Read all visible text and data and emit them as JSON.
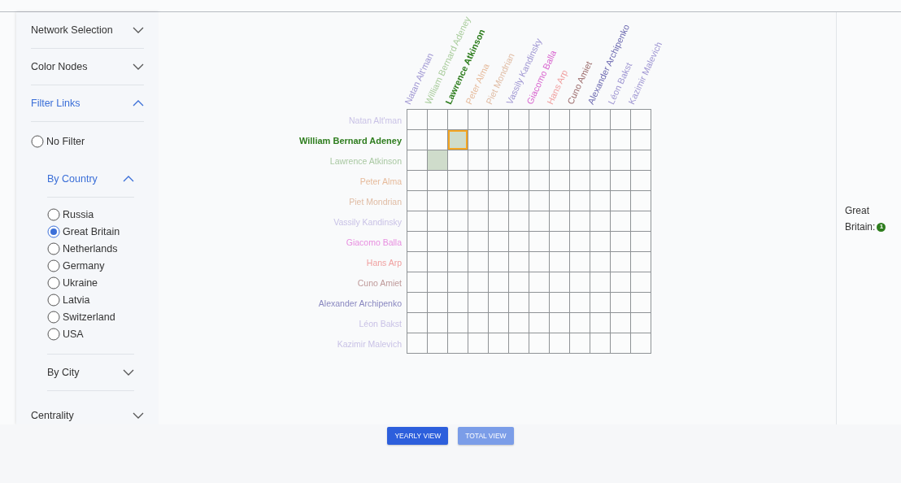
{
  "sidebar": {
    "sections": [
      {
        "title": "Network Selection",
        "expanded": false
      },
      {
        "title": "Color Nodes",
        "expanded": false
      },
      {
        "title": "Filter Links",
        "expanded": true,
        "options": [
          {
            "label": "No Filter",
            "selected": false
          }
        ],
        "subsections": [
          {
            "title": "By Country",
            "expanded": true,
            "options": [
              {
                "label": "Russia",
                "selected": false
              },
              {
                "label": "Great Britain",
                "selected": true
              },
              {
                "label": "Netherlands",
                "selected": false
              },
              {
                "label": "Germany",
                "selected": false
              },
              {
                "label": "Ukraine",
                "selected": false
              },
              {
                "label": "Latvia",
                "selected": false
              },
              {
                "label": "Switzerland",
                "selected": false
              },
              {
                "label": "USA",
                "selected": false
              }
            ]
          },
          {
            "title": "By City",
            "expanded": false
          }
        ]
      },
      {
        "title": "Centrality",
        "expanded": false
      }
    ]
  },
  "matrix": {
    "columns": [
      {
        "label": "Natan Alt'man",
        "color": "#9f96d2",
        "highlighted": false
      },
      {
        "label": "William Bernard Adeney",
        "color": "#a9cc9c",
        "highlighted": false
      },
      {
        "label": "Lawrence Atkinson",
        "color": "#2e7d1e",
        "highlighted": true
      },
      {
        "label": "Peter Alma",
        "color": "#e6bb9c",
        "highlighted": false
      },
      {
        "label": "Piet Mondrian",
        "color": "#e0bca4",
        "highlighted": false
      },
      {
        "label": "Vassily Kandinsky",
        "color": "#9f96d2",
        "highlighted": false
      },
      {
        "label": "Giacomo Balla",
        "color": "#d864cf",
        "highlighted": false
      },
      {
        "label": "Hans Arp",
        "color": "#f0a0a0",
        "highlighted": false
      },
      {
        "label": "Cuno Amiet",
        "color": "#9c6c6c",
        "highlighted": false
      },
      {
        "label": "Alexander Archipenko",
        "color": "#6c69b0",
        "highlighted": false
      },
      {
        "label": "Léon Bakst",
        "color": "#9f96d2",
        "highlighted": false
      },
      {
        "label": "Kazimir Malevich",
        "color": "#9f96d2",
        "highlighted": false
      }
    ],
    "rows": [
      {
        "label": "Natan Alt'man",
        "color": "#c9c2e6",
        "highlighted": false,
        "cells": [
          {
            "filled": false,
            "selected": false
          },
          {
            "filled": false,
            "selected": false
          },
          {
            "filled": false,
            "selected": false
          },
          {
            "filled": false,
            "selected": false
          },
          {
            "filled": false,
            "selected": false
          },
          {
            "filled": false,
            "selected": false
          },
          {
            "filled": false,
            "selected": false
          },
          {
            "filled": false,
            "selected": false
          },
          {
            "filled": false,
            "selected": false
          },
          {
            "filled": false,
            "selected": false
          },
          {
            "filled": false,
            "selected": false
          },
          {
            "filled": false,
            "selected": false
          }
        ]
      },
      {
        "label": "William Bernard Adeney",
        "color": "#2e7d1e",
        "highlighted": true,
        "cells": [
          {
            "filled": false,
            "selected": false
          },
          {
            "filled": false,
            "selected": false
          },
          {
            "filled": true,
            "selected": true
          },
          {
            "filled": false,
            "selected": false
          },
          {
            "filled": false,
            "selected": false
          },
          {
            "filled": false,
            "selected": false
          },
          {
            "filled": false,
            "selected": false
          },
          {
            "filled": false,
            "selected": false
          },
          {
            "filled": false,
            "selected": false
          },
          {
            "filled": false,
            "selected": false
          },
          {
            "filled": false,
            "selected": false
          },
          {
            "filled": false,
            "selected": false
          }
        ]
      },
      {
        "label": "Lawrence Atkinson",
        "color": "#a9c8a2",
        "highlighted": false,
        "cells": [
          {
            "filled": false,
            "selected": false
          },
          {
            "filled": true,
            "selected": false
          },
          {
            "filled": false,
            "selected": false
          },
          {
            "filled": false,
            "selected": false
          },
          {
            "filled": false,
            "selected": false
          },
          {
            "filled": false,
            "selected": false
          },
          {
            "filled": false,
            "selected": false
          },
          {
            "filled": false,
            "selected": false
          },
          {
            "filled": false,
            "selected": false
          },
          {
            "filled": false,
            "selected": false
          },
          {
            "filled": false,
            "selected": false
          },
          {
            "filled": false,
            "selected": false
          }
        ]
      },
      {
        "label": "Peter Alma",
        "color": "#e6bb9c",
        "highlighted": false,
        "cells": [
          {
            "filled": false,
            "selected": false
          },
          {
            "filled": false,
            "selected": false
          },
          {
            "filled": false,
            "selected": false
          },
          {
            "filled": false,
            "selected": false
          },
          {
            "filled": false,
            "selected": false
          },
          {
            "filled": false,
            "selected": false
          },
          {
            "filled": false,
            "selected": false
          },
          {
            "filled": false,
            "selected": false
          },
          {
            "filled": false,
            "selected": false
          },
          {
            "filled": false,
            "selected": false
          },
          {
            "filled": false,
            "selected": false
          },
          {
            "filled": false,
            "selected": false
          }
        ]
      },
      {
        "label": "Piet Mondrian",
        "color": "#e0bca4",
        "highlighted": false,
        "cells": [
          {
            "filled": false,
            "selected": false
          },
          {
            "filled": false,
            "selected": false
          },
          {
            "filled": false,
            "selected": false
          },
          {
            "filled": false,
            "selected": false
          },
          {
            "filled": false,
            "selected": false
          },
          {
            "filled": false,
            "selected": false
          },
          {
            "filled": false,
            "selected": false
          },
          {
            "filled": false,
            "selected": false
          },
          {
            "filled": false,
            "selected": false
          },
          {
            "filled": false,
            "selected": false
          },
          {
            "filled": false,
            "selected": false
          },
          {
            "filled": false,
            "selected": false
          }
        ]
      },
      {
        "label": "Vassily Kandinsky",
        "color": "#c9c2e6",
        "highlighted": false,
        "cells": [
          {
            "filled": false,
            "selected": false
          },
          {
            "filled": false,
            "selected": false
          },
          {
            "filled": false,
            "selected": false
          },
          {
            "filled": false,
            "selected": false
          },
          {
            "filled": false,
            "selected": false
          },
          {
            "filled": false,
            "selected": false
          },
          {
            "filled": false,
            "selected": false
          },
          {
            "filled": false,
            "selected": false
          },
          {
            "filled": false,
            "selected": false
          },
          {
            "filled": false,
            "selected": false
          },
          {
            "filled": false,
            "selected": false
          },
          {
            "filled": false,
            "selected": false
          }
        ]
      },
      {
        "label": "Giacomo Balla",
        "color": "#e88fe0",
        "highlighted": false,
        "cells": [
          {
            "filled": false,
            "selected": false
          },
          {
            "filled": false,
            "selected": false
          },
          {
            "filled": false,
            "selected": false
          },
          {
            "filled": false,
            "selected": false
          },
          {
            "filled": false,
            "selected": false
          },
          {
            "filled": false,
            "selected": false
          },
          {
            "filled": false,
            "selected": false
          },
          {
            "filled": false,
            "selected": false
          },
          {
            "filled": false,
            "selected": false
          },
          {
            "filled": false,
            "selected": false
          },
          {
            "filled": false,
            "selected": false
          },
          {
            "filled": false,
            "selected": false
          }
        ]
      },
      {
        "label": "Hans Arp",
        "color": "#f0a0a0",
        "highlighted": false,
        "cells": [
          {
            "filled": false,
            "selected": false
          },
          {
            "filled": false,
            "selected": false
          },
          {
            "filled": false,
            "selected": false
          },
          {
            "filled": false,
            "selected": false
          },
          {
            "filled": false,
            "selected": false
          },
          {
            "filled": false,
            "selected": false
          },
          {
            "filled": false,
            "selected": false
          },
          {
            "filled": false,
            "selected": false
          },
          {
            "filled": false,
            "selected": false
          },
          {
            "filled": false,
            "selected": false
          },
          {
            "filled": false,
            "selected": false
          },
          {
            "filled": false,
            "selected": false
          }
        ]
      },
      {
        "label": "Cuno Amiet",
        "color": "#bf9a9a",
        "highlighted": false,
        "cells": [
          {
            "filled": false,
            "selected": false
          },
          {
            "filled": false,
            "selected": false
          },
          {
            "filled": false,
            "selected": false
          },
          {
            "filled": false,
            "selected": false
          },
          {
            "filled": false,
            "selected": false
          },
          {
            "filled": false,
            "selected": false
          },
          {
            "filled": false,
            "selected": false
          },
          {
            "filled": false,
            "selected": false
          },
          {
            "filled": false,
            "selected": false
          },
          {
            "filled": false,
            "selected": false
          },
          {
            "filled": false,
            "selected": false
          },
          {
            "filled": false,
            "selected": false
          }
        ]
      },
      {
        "label": "Alexander Archipenko",
        "color": "#8a88c0",
        "highlighted": false,
        "cells": [
          {
            "filled": false,
            "selected": false
          },
          {
            "filled": false,
            "selected": false
          },
          {
            "filled": false,
            "selected": false
          },
          {
            "filled": false,
            "selected": false
          },
          {
            "filled": false,
            "selected": false
          },
          {
            "filled": false,
            "selected": false
          },
          {
            "filled": false,
            "selected": false
          },
          {
            "filled": false,
            "selected": false
          },
          {
            "filled": false,
            "selected": false
          },
          {
            "filled": false,
            "selected": false
          },
          {
            "filled": false,
            "selected": false
          },
          {
            "filled": false,
            "selected": false
          }
        ]
      },
      {
        "label": "Léon Bakst",
        "color": "#c9c2e6",
        "highlighted": false,
        "cells": [
          {
            "filled": false,
            "selected": false
          },
          {
            "filled": false,
            "selected": false
          },
          {
            "filled": false,
            "selected": false
          },
          {
            "filled": false,
            "selected": false
          },
          {
            "filled": false,
            "selected": false
          },
          {
            "filled": false,
            "selected": false
          },
          {
            "filled": false,
            "selected": false
          },
          {
            "filled": false,
            "selected": false
          },
          {
            "filled": false,
            "selected": false
          },
          {
            "filled": false,
            "selected": false
          },
          {
            "filled": false,
            "selected": false
          },
          {
            "filled": false,
            "selected": false
          }
        ]
      },
      {
        "label": "Kazimir Malevich",
        "color": "#c9c2e6",
        "highlighted": false,
        "cells": [
          {
            "filled": false,
            "selected": false
          },
          {
            "filled": false,
            "selected": false
          },
          {
            "filled": false,
            "selected": false
          },
          {
            "filled": false,
            "selected": false
          },
          {
            "filled": false,
            "selected": false
          },
          {
            "filled": false,
            "selected": false
          },
          {
            "filled": false,
            "selected": false
          },
          {
            "filled": false,
            "selected": false
          },
          {
            "filled": false,
            "selected": false
          },
          {
            "filled": false,
            "selected": false
          },
          {
            "filled": false,
            "selected": false
          },
          {
            "filled": false,
            "selected": false
          }
        ]
      }
    ]
  },
  "legend": {
    "items": [
      {
        "label": "Great Britain:",
        "count": "1",
        "color": "#2e7d1e"
      }
    ]
  },
  "view_buttons": [
    {
      "label": "YEARLY VIEW",
      "selected": true
    },
    {
      "label": "TOTAL VIEW",
      "selected": false
    }
  ]
}
